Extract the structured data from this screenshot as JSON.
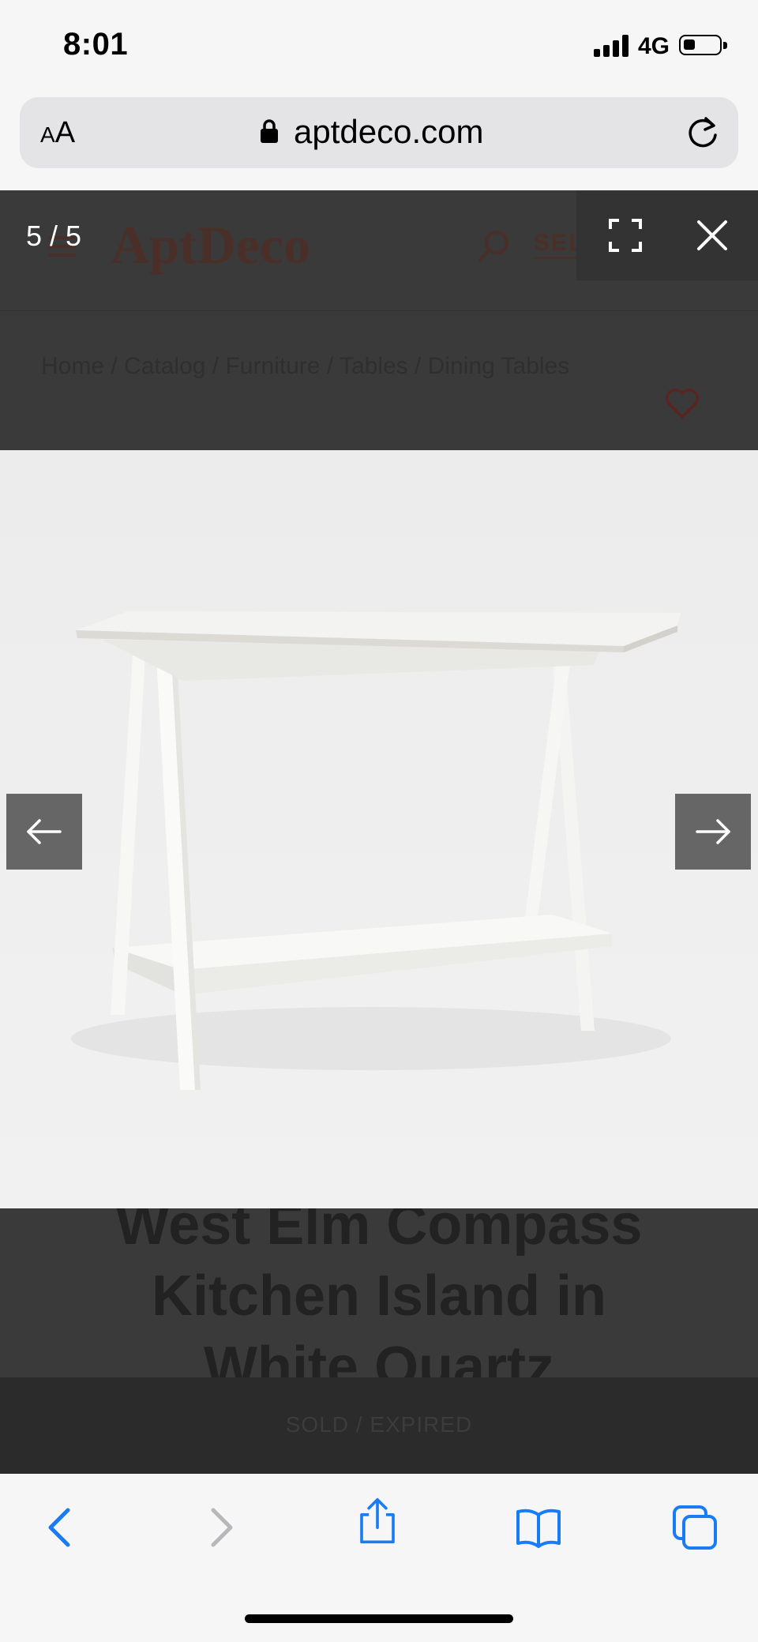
{
  "status_bar": {
    "time": "8:01",
    "network": "4G"
  },
  "browser": {
    "text_size_small": "A",
    "text_size_large": "A",
    "domain": "aptdeco.com"
  },
  "site": {
    "logo_text": "AptDeco",
    "sell_label": "SELL",
    "breadcrumb": "Home / Catalog / Furniture / Tables / Dining Tables",
    "product_title_lines": [
      "West Elm Compass",
      "Kitchen Island in",
      "White Quartz"
    ],
    "status_label": "SOLD / EXPIRED",
    "brand_color": "#4a2e28"
  },
  "lightbox": {
    "counter": "5 / 5",
    "image_subject": "white-kitchen-island-with-quartz-top-and-lower-shelf"
  },
  "toolbar": {
    "accent_color": "#1a7cf4",
    "icons": [
      "back-icon",
      "forward-icon",
      "share-icon",
      "bookmarks-icon",
      "tabs-icon"
    ]
  }
}
